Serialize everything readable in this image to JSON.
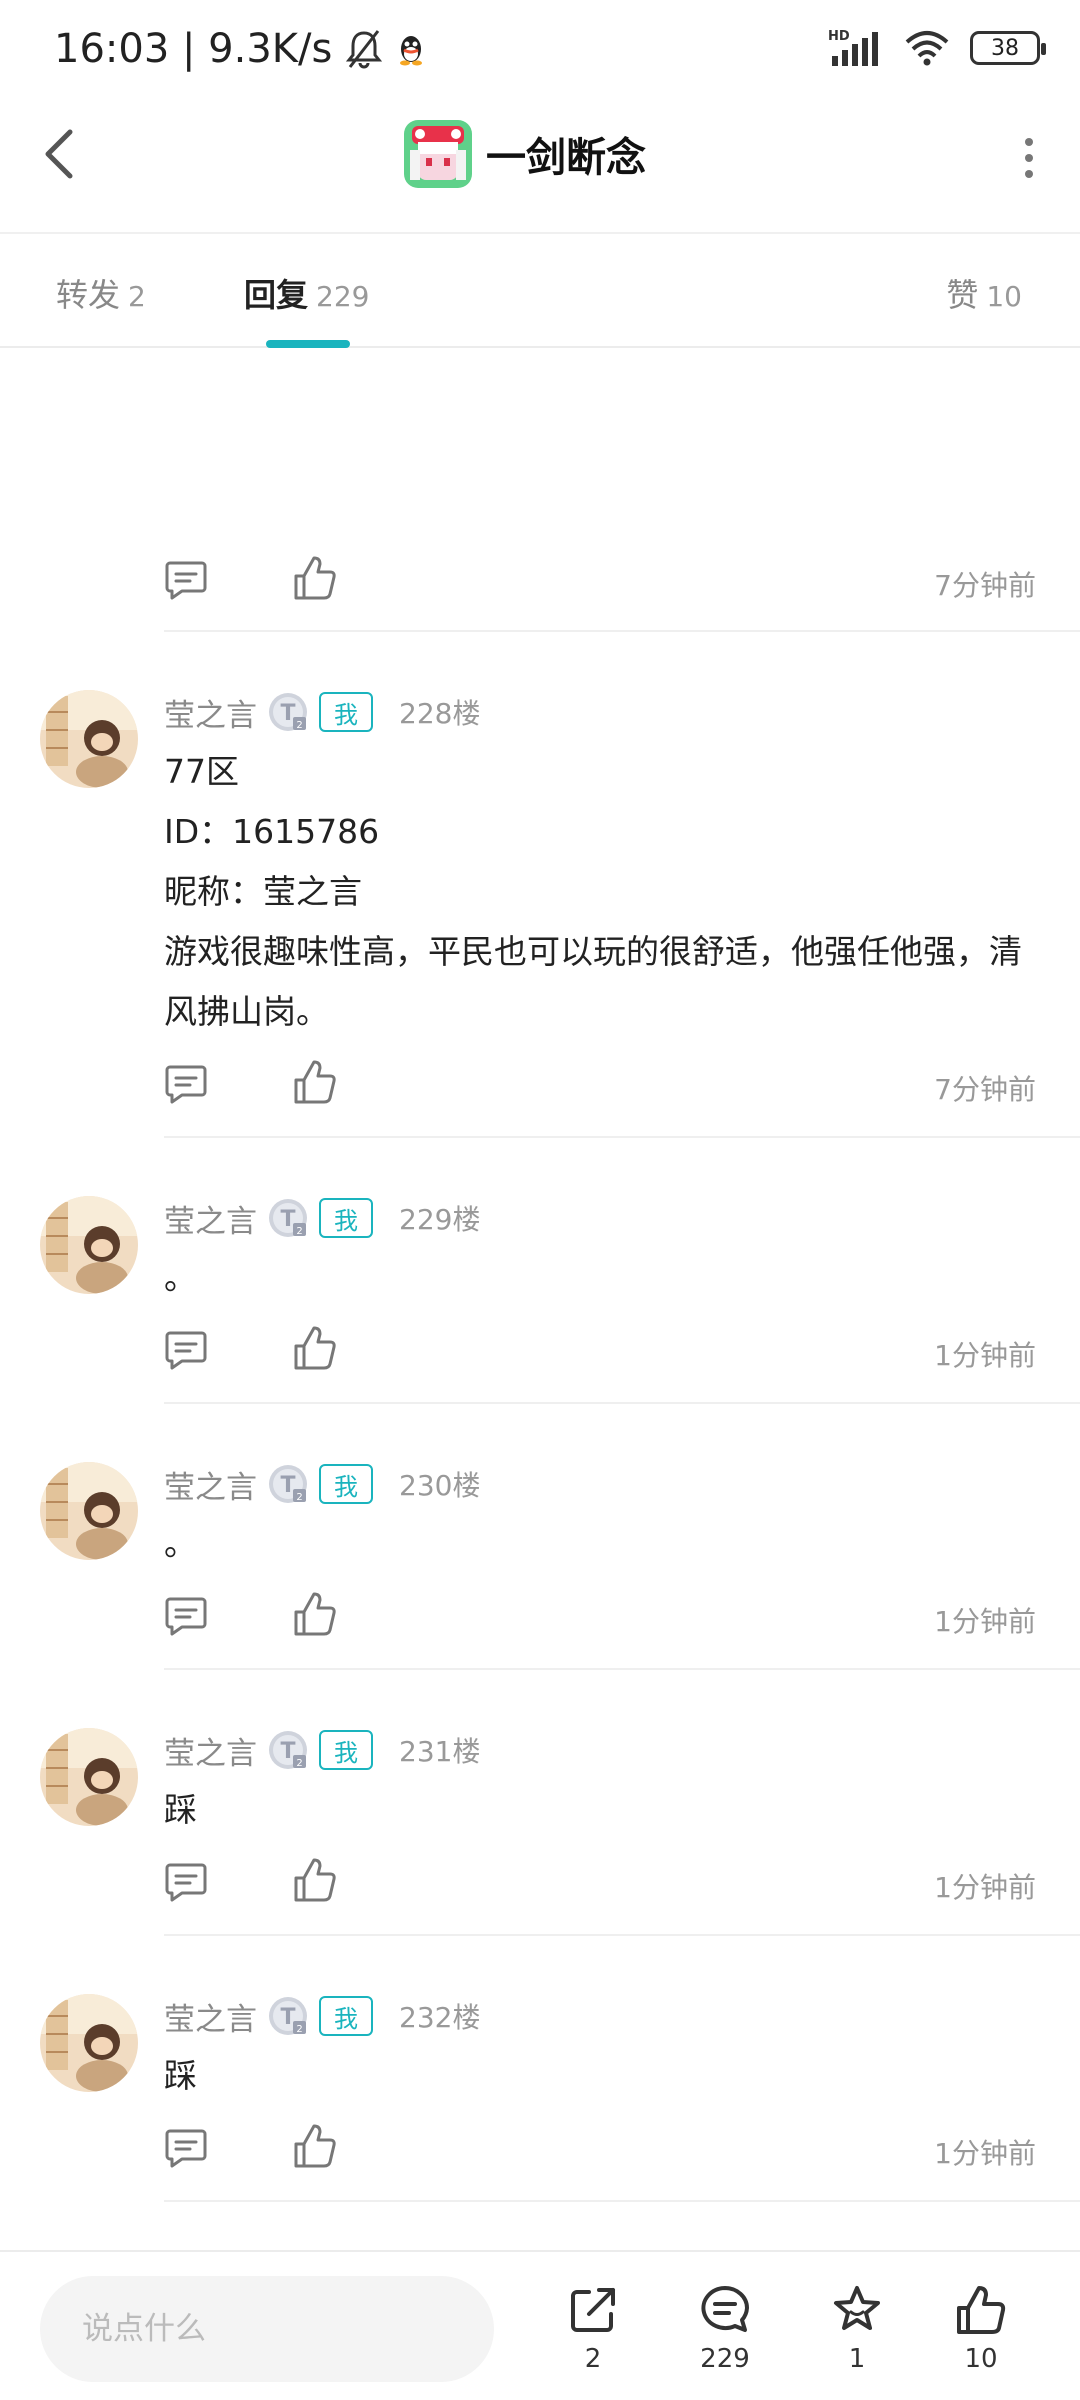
{
  "status_bar": {
    "time_speed": "16:03 | 9.3K/s",
    "battery": "38"
  },
  "header": {
    "title": "一剑断念"
  },
  "tabs": [
    {
      "label": "转发",
      "count": "2"
    },
    {
      "label": "回复",
      "count": "229"
    },
    {
      "label": "赞",
      "count": "10"
    }
  ],
  "top_actions": {
    "time": "7分钟前"
  },
  "comments": [
    {
      "name": "莹之言",
      "badge": "我",
      "floor": "228楼",
      "lines": [
        "77区",
        "ID：1615786",
        "昵称：莹之言",
        "游戏很趣味性高，平民也可以玩的很舒适，他强任他强，清",
        "风拂山岗。"
      ],
      "time": "7分钟前"
    },
    {
      "name": "莹之言",
      "badge": "我",
      "floor": "229楼",
      "lines": [
        "。"
      ],
      "time": "1分钟前"
    },
    {
      "name": "莹之言",
      "badge": "我",
      "floor": "230楼",
      "lines": [
        "。"
      ],
      "time": "1分钟前"
    },
    {
      "name": "莹之言",
      "badge": "我",
      "floor": "231楼",
      "lines": [
        "踩"
      ],
      "time": "1分钟前"
    },
    {
      "name": "莹之言",
      "badge": "我",
      "floor": "232楼",
      "lines": [
        "踩"
      ],
      "time": "1分钟前"
    }
  ],
  "bottom_bar": {
    "input_placeholder": "说点什么",
    "share_count": "2",
    "comment_count": "229",
    "favorite_count": "1",
    "like_count": "10"
  },
  "colors": {
    "accent": "#1ab4be"
  }
}
